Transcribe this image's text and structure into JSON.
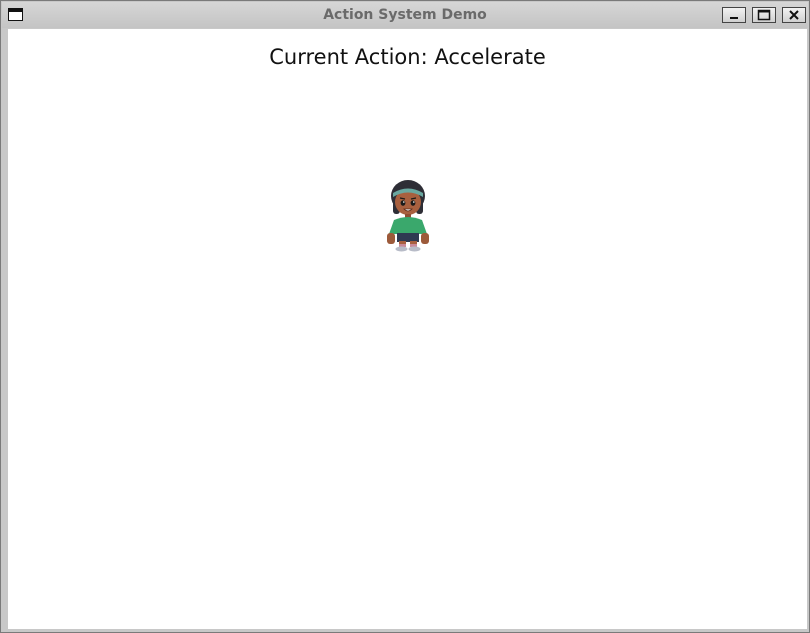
{
  "window": {
    "title": "Action System Demo",
    "buttons": {
      "menu": "window-menu-icon",
      "minimize": "minimize-icon",
      "maximize": "maximize-icon",
      "close": "close-icon"
    }
  },
  "game": {
    "status_text": "Current Action: Accelerate",
    "player_sprite": "girl-character-sprite"
  }
}
